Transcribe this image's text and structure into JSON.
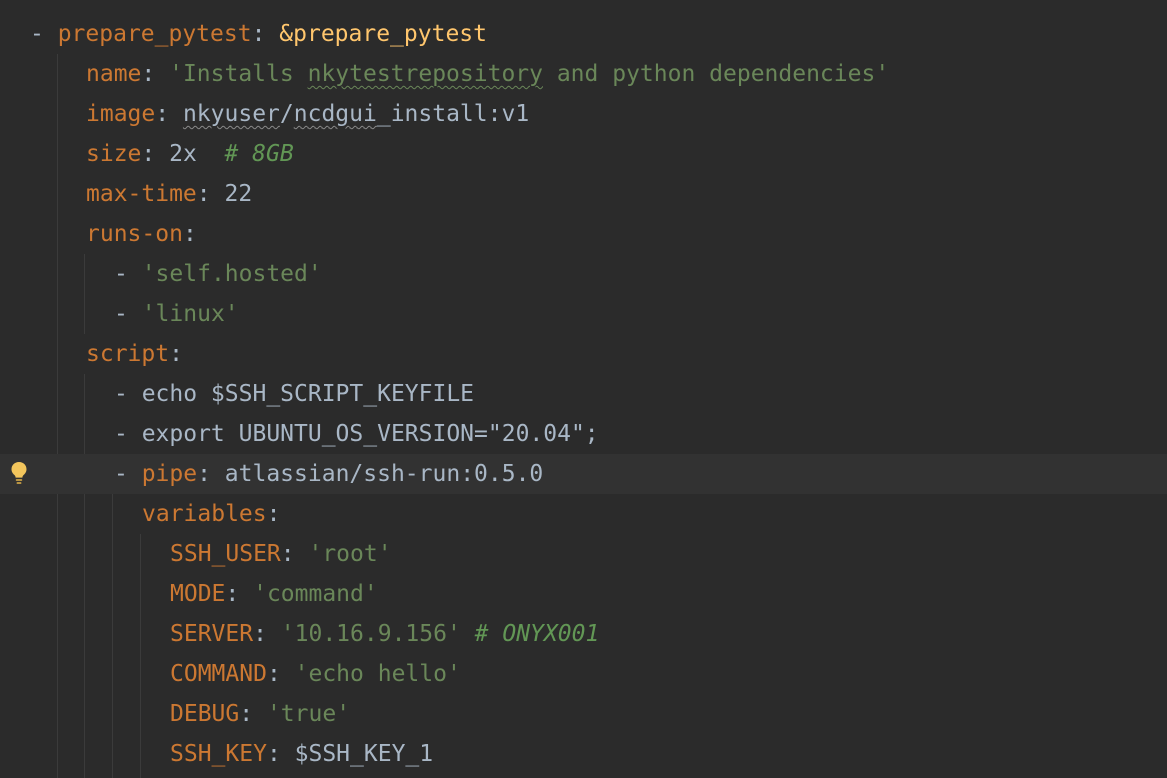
{
  "editor": {
    "language": "yaml",
    "colors": {
      "background": "#2b2b2b",
      "current_line": "#323232",
      "key": "#cc7832",
      "anchor": "#ffc66d",
      "string": "#6a8759",
      "comment": "#629755",
      "plain": "#a9b7c6"
    },
    "gutter_icon": "lightbulb-icon",
    "lines": [
      {
        "dash": "- ",
        "key": "prepare_pytest",
        "sep": ": ",
        "anchor": "&prepare_pytest"
      },
      {
        "key": "name",
        "sep": ": ",
        "str_open": "'Installs ",
        "str_typo": "nkytestrepository",
        "str_close": " and python dependencies'"
      },
      {
        "key": "image",
        "sep": ": ",
        "v_typo1": "nkyuser",
        "v_mid": "/",
        "v_typo2": "ncdgui",
        "v_rest": "_install:v1"
      },
      {
        "key": "size",
        "sep": ": ",
        "value": "2x  ",
        "comment": "# 8GB"
      },
      {
        "key": "max-time",
        "sep": ": ",
        "value": "22"
      },
      {
        "key": "runs-on",
        "sep": ":"
      },
      {
        "dash": "- ",
        "string": "'self.hosted'"
      },
      {
        "dash": "- ",
        "string": "'linux'"
      },
      {
        "key": "script",
        "sep": ":"
      },
      {
        "text": "- echo $SSH_SCRIPT_KEYFILE"
      },
      {
        "text": "- export UBUNTU_OS_VERSION=\"20.04\";"
      },
      {
        "dash": "- ",
        "key": "pipe",
        "sep": ": ",
        "value": "atlassian/ssh-run:0.5.0"
      },
      {
        "key": "variables",
        "sep": ":"
      },
      {
        "key": "SSH_USER",
        "sep": ": ",
        "string": "'root'"
      },
      {
        "key": "MODE",
        "sep": ": ",
        "string": "'command'"
      },
      {
        "key": "SERVER",
        "sep": ": ",
        "string": "'10.16.9.156' ",
        "comment": "# ONYX001"
      },
      {
        "key": "COMMAND",
        "sep": ": ",
        "string": "'echo hello'"
      },
      {
        "key": "DEBUG",
        "sep": ": ",
        "string": "'true'"
      },
      {
        "key": "SSH_KEY",
        "sep": ": ",
        "value": "$SSH_KEY_1"
      }
    ]
  }
}
